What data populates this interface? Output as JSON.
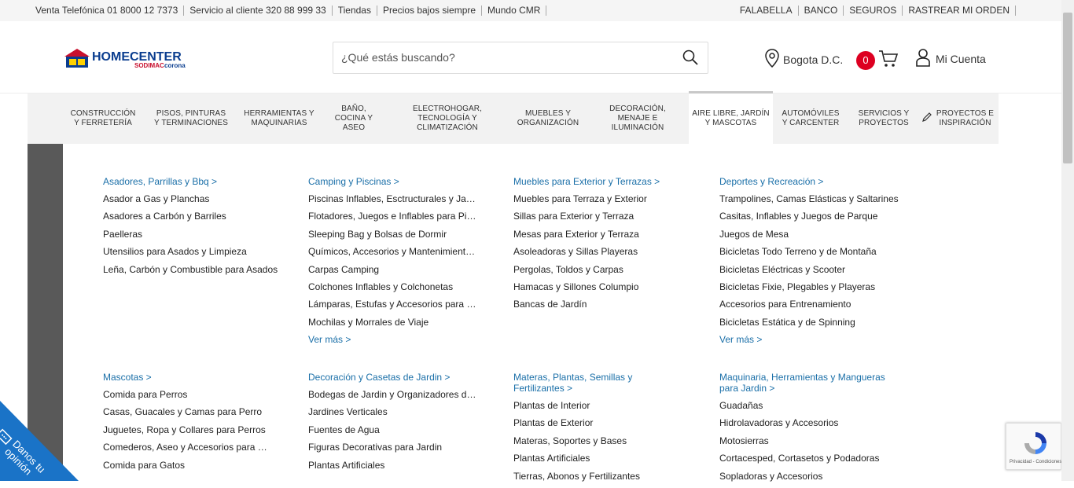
{
  "topbar": {
    "left": [
      "Venta Telefónica 01 8000 12 7373",
      "Servicio al cliente 320 88 999 33",
      "Tiendas",
      "Precios bajos siempre",
      "Mundo CMR"
    ],
    "right": [
      "FALABELLA",
      "BANCO",
      "SEGUROS",
      "RASTREAR MI ORDEN"
    ]
  },
  "header": {
    "logo_main": "HOMECENTER",
    "logo_sub": "SODIMAC corona",
    "search_placeholder": "¿Qué estás buscando?",
    "location": "Bogota D.C.",
    "cart_count": "0",
    "account": "Mi Cuenta"
  },
  "nav": [
    "CONSTRUCCIÓN Y FERRETERÍA",
    "PISOS, PINTURAS Y TERMINACIONES",
    "HERRAMIENTAS Y MAQUINARIAS",
    "BAÑO, COCINA Y ASEO",
    "ELECTROHOGAR, TECNOLOGÍA Y CLIMATIZACIÓN",
    "MUEBLES Y ORGANIZACIÓN",
    "DECORACIÓN, MENAJE E ILUMINACIÓN",
    "AIRE LIBRE, JARDÍN Y MASCOTAS",
    "AUTOMÓVILES Y CARCENTER",
    "SERVICIOS Y PROYECTOS",
    "PROYECTOS E INSPIRACIÓN"
  ],
  "menu": {
    "row1": [
      {
        "head": "Asadores, Parrillas y Bbq >",
        "items": [
          "Asador a Gas y Planchas",
          "Asadores a Carbón y Barriles",
          "Paelleras",
          "Utensilios para Asados y Limpieza",
          "Leña, Carbón y Combustible para Asados"
        ],
        "more": ""
      },
      {
        "head": "Camping y Piscinas >",
        "items": [
          "Piscinas Inflables, Esctructurales y Jacu...",
          "Flotadores, Juegos e Inflables para Pisci...",
          "Sleeping Bag y Bolsas de Dormir",
          "Químicos, Accesorios y Mantenimiento...",
          "Carpas Camping",
          "Colchones Inflables y Colchonetas",
          "Lámparas, Estufas y Accesorios para Ca...",
          "Mochilas y Morrales de Viaje"
        ],
        "more": "Ver más >"
      },
      {
        "head": "Muebles para Exterior y Terrazas >",
        "items": [
          "Muebles para Terraza y Exterior",
          "Sillas para Exterior y Terraza",
          "Mesas para Exterior y Terraza",
          "Asoleadoras y Sillas Playeras",
          "Pergolas, Toldos y Carpas",
          "Hamacas y Sillones Columpio",
          "Bancas de Jardín"
        ],
        "more": ""
      },
      {
        "head": "Deportes y Recreación >",
        "items": [
          "Trampolines, Camas Elásticas y Saltarines",
          "Casitas, Inflables y Juegos de Parque",
          "Juegos de Mesa",
          "Bicicletas Todo Terreno y de Montaña",
          "Bicicletas Eléctricas y Scooter",
          "Bicicletas Fixie, Plegables y Playeras",
          "Accesorios para Entrenamiento",
          "Bicicletas Estática y de Spinning"
        ],
        "more": "Ver más >"
      }
    ],
    "row2": [
      {
        "head": "Mascotas >",
        "items": [
          "Comida para Perros",
          "Casas, Guacales y Camas para Perro",
          "Juguetes, Ropa y Collares para Perros",
          "Comederos, Aseo y Accesorios para Pe...",
          "Comida para Gatos"
        ]
      },
      {
        "head": "Decoración y Casetas de Jardin >",
        "items": [
          "Bodegas de Jardin y Organizadores de ...",
          "Jardines Verticales",
          "Fuentes de Agua",
          "Figuras Decorativas para Jardin",
          "Plantas Artificiales"
        ]
      },
      {
        "head": "Materas, Plantas, Semillas y Fertilizantes >",
        "items": [
          "Plantas de Interior",
          "Plantas de Exterior",
          "Materas, Soportes y Bases",
          "Plantas Artificiales",
          "Tierras, Abonos y Fertilizantes"
        ]
      },
      {
        "head": "Maquinaria, Herramientas y Mangueras para Jardin >",
        "items": [
          "Guadañas",
          "Hidrolavadoras y Accesorios",
          "Motosierras",
          "Cortacesped, Cortasetos y Podadoras",
          "Sopladoras y Accesorios"
        ]
      }
    ]
  },
  "opinion": "Danos tu opinión",
  "recaptcha": "Privacidad - Condiciones"
}
